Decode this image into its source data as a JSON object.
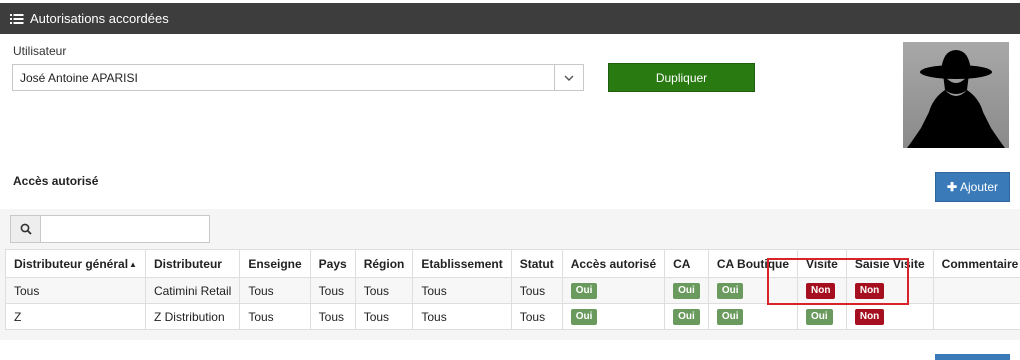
{
  "header": {
    "title": "Autorisations accordées",
    "icon": "list-icon"
  },
  "user": {
    "label": "Utilisateur",
    "selected": "José Antoine APARISI",
    "caret_icon": "chevron-down-icon"
  },
  "buttons": {
    "duplicate": "Dupliquer",
    "add": "Ajouter",
    "add_icon": "plus-icon"
  },
  "access": {
    "title": "Accès autorisé",
    "search_placeholder": ""
  },
  "table": {
    "headers": [
      "Distributeur général",
      "Distributeur",
      "Enseigne",
      "Pays",
      "Région",
      "Etablissement",
      "Statut",
      "Accès autorisé",
      "CA",
      "CA Boutique",
      "Visite",
      "Saisie Visite",
      "Commentaire"
    ],
    "rows": [
      {
        "distributeur_general": "Tous",
        "distributeur": "Catimini Retail",
        "enseigne": "Tous",
        "pays": "Tous",
        "region": "Tous",
        "etablissement": "Tous",
        "statut": "Tous",
        "acces": "Oui",
        "ca": "Oui",
        "ca_boutique": "Oui",
        "visite": "Non",
        "saisie_visite": "Non",
        "commentaire": ""
      },
      {
        "distributeur_general": "Z",
        "distributeur": "Z Distribution",
        "enseigne": "Tous",
        "pays": "Tous",
        "region": "Tous",
        "etablissement": "Tous",
        "statut": "Tous",
        "acces": "Oui",
        "ca": "Oui",
        "ca_boutique": "Oui",
        "visite": "Oui",
        "saisie_visite": "Non",
        "commentaire": ""
      }
    ]
  },
  "colors": {
    "header_bg": "#3d3d3d",
    "duplicate_bg": "#2a7a12",
    "add_bg": "#3a7ab8",
    "oui": "#6a9a5d",
    "non": "#a50f1f",
    "highlight": "#d9232a"
  }
}
